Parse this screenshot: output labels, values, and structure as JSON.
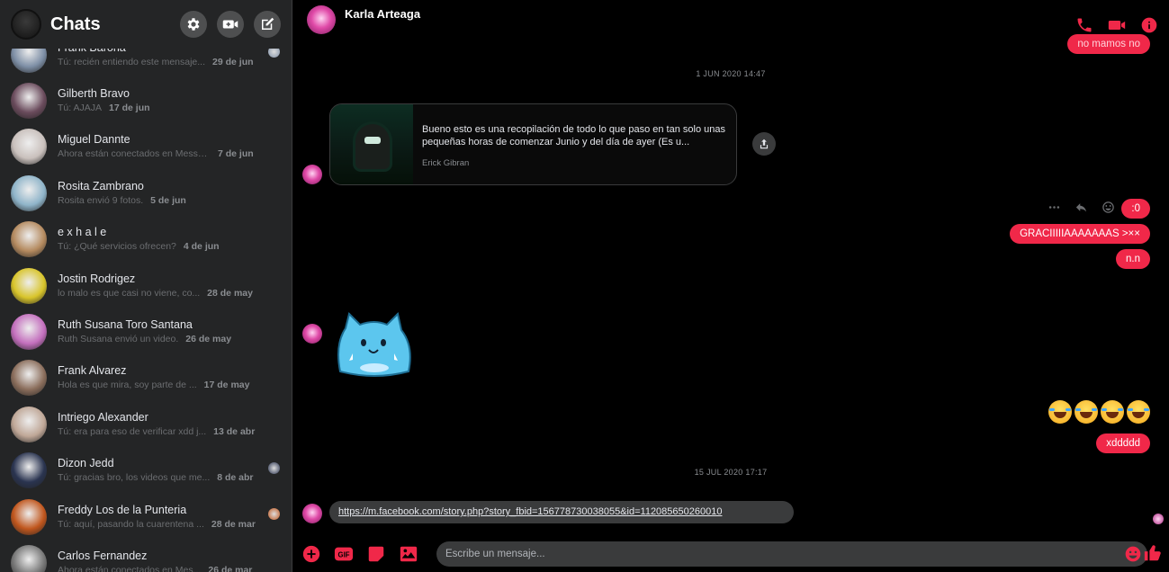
{
  "sidebar": {
    "title": "Chats",
    "chats": [
      {
        "name": "Frank Barona",
        "preview": "Tú: recién entiendo este mensaje...",
        "date": "29 de jun",
        "avatar": "#7e8fa6",
        "read": true
      },
      {
        "name": "Gilberth Bravo",
        "preview": "Tú: AJAJA",
        "date": "17 de jun",
        "avatar": "#6a4b5c",
        "read": false
      },
      {
        "name": "Miguel Dannte",
        "preview": "Ahora están conectados en Messe...",
        "date": "7 de jun",
        "avatar": "#c9c0bc",
        "read": false
      },
      {
        "name": "Rosita Zambrano",
        "preview": "Rosita envió 9 fotos.",
        "date": "5 de jun",
        "avatar": "#8fb4c9",
        "read": false
      },
      {
        "name": "e x h a l e",
        "preview": "Tú: ¿Qué servicios ofrecen?",
        "date": "4 de jun",
        "avatar": "#b48a5f",
        "read": false
      },
      {
        "name": "Jostin Rodrigez",
        "preview": "lo malo es que casi no viene, co...",
        "date": "28 de may",
        "avatar": "#d8c42a",
        "read": false
      },
      {
        "name": "Ruth Susana Toro Santana",
        "preview": "Ruth Susana envió un video.",
        "date": "26 de may",
        "avatar": "#c36fbd",
        "read": false
      },
      {
        "name": "Frank Alvarez",
        "preview": "Hola es que mira, soy parte de ...",
        "date": "17 de may",
        "avatar": "#8b6e5c",
        "read": false
      },
      {
        "name": "Intriego Alexander",
        "preview": "Tú: era para eso de verificar xdd j...",
        "date": "13 de abr",
        "avatar": "#bfa797",
        "read": false
      },
      {
        "name": "Dizon Jedd",
        "preview": "Tú: gracias bro, los videos que me...",
        "date": "8 de abr",
        "avatar": "#2a3450",
        "read": true
      },
      {
        "name": "Freddy Los de la Punteria",
        "preview": "Tú: aquí, pasando la cuarentena ...",
        "date": "28 de mar",
        "avatar": "#c0561d",
        "read": true
      },
      {
        "name": "Carlos Fernandez",
        "preview": "Ahora están conectados en Mes...",
        "date": "26 de mar",
        "avatar": "#777777",
        "read": false
      }
    ]
  },
  "conversation": {
    "contact_name": "Karla Arteaga",
    "timestamp_1": "1 JUN 2020 14:47",
    "shared_post": {
      "text": "Bueno esto es una recopilación de todo lo que paso en tan solo unas pequeñas horas de comenzar Junio y del día de ayer (Es u...",
      "author": "Erick Gibran"
    },
    "top_partial_message": "no mamos no",
    "outgoing_group": [
      ":0",
      "GRACIIIIIAAAAAAAS >××",
      "n.n"
    ],
    "emoji_message": "🤣🤣🤣🤣",
    "last_outgoing": "xddddd",
    "timestamp_2": "15 JUL 2020 17:17",
    "link_message": "https://m.facebook.com/story.php?story_fbid=156778730038055&id=112085650260010"
  },
  "composer": {
    "placeholder": "Escribe un mensaje..."
  },
  "colors": {
    "accent": "#f02849",
    "sidebar_bg": "#242526",
    "bubble_gray": "#3a3b3c"
  }
}
